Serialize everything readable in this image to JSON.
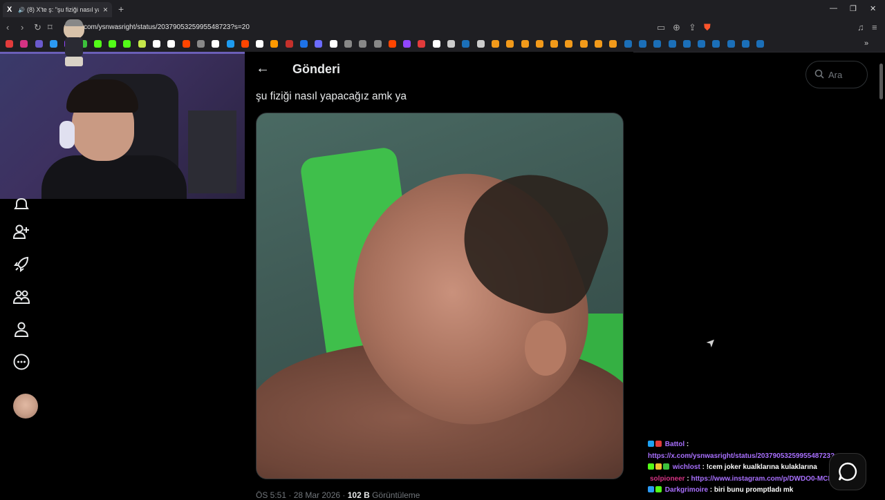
{
  "browser": {
    "tab_title": "(8) X'te ş: \"şu fiziği nasıl yapa",
    "tab_icon": "x-logo-icon",
    "url": "com/ysnwasright/status/2037905325995548723?s=20",
    "bookmark_colors": [
      "#e23b3b",
      "#d63384",
      "#6a5acd",
      "#2b9af3",
      "#9146ff",
      "#3cc13b",
      "#53fc18",
      "#53fc18",
      "#53fc18",
      "#c6e84a",
      "#fff",
      "#fff",
      "#ff4500",
      "#888",
      "#fff",
      "#1d9bf0",
      "#ff4500",
      "#fff",
      "#ff9900",
      "#c4302b",
      "#1e73e8",
      "#6c6cff",
      "#fff",
      "#888",
      "#888",
      "#888",
      "#ff4500",
      "#9146ff",
      "#e23b3b",
      "#fff",
      "#ccc",
      "#1b6fb8",
      "#ccc",
      "#f29a1a",
      "#f29a1a",
      "#f29a1a",
      "#f29a1a",
      "#f29a1a",
      "#f29a1a",
      "#f29a1a",
      "#f29a1a",
      "#f29a1a",
      "#1b6fb8",
      "#1b6fb8",
      "#1b6fb8",
      "#1b6fb8",
      "#1b6fb8",
      "#1b6fb8",
      "#1b6fb8",
      "#1b6fb8",
      "#1b6fb8",
      "#1b6fb8"
    ]
  },
  "post": {
    "header_title": "Gönderi",
    "text": "şu fiziği nasıl yapacağız amk ya",
    "timestamp_prefix": "ÖS 5:51 · 28 Mar 2026 · ",
    "views_count": "102 B",
    "views_label": " Görüntüleme"
  },
  "search": {
    "placeholder": "Ara"
  },
  "sidebar": {
    "icons": [
      "bell-icon",
      "follow-icon",
      "rocket-icon",
      "communities-icon",
      "profile-icon",
      "more-icon"
    ]
  },
  "chat": {
    "messages": [
      {
        "user": "Battol",
        "color": "#a970ff",
        "text": "https://x.com/ysnwasright/status/2037905325995548723?s=20",
        "is_link": true
      },
      {
        "user": "wichlost",
        "color": "#a970ff",
        "text": "!cem joker kualklarına kulaklarına",
        "is_link": false
      },
      {
        "user": "solpioneer",
        "color": "#d63384",
        "text": "https://www.instagram.com/p/DWDO0-MCNso",
        "is_link": true
      },
      {
        "user": "Darkgrimoire",
        "color": "#a970ff",
        "text": "biri bunu promptladı mk",
        "is_link": false
      }
    ]
  }
}
